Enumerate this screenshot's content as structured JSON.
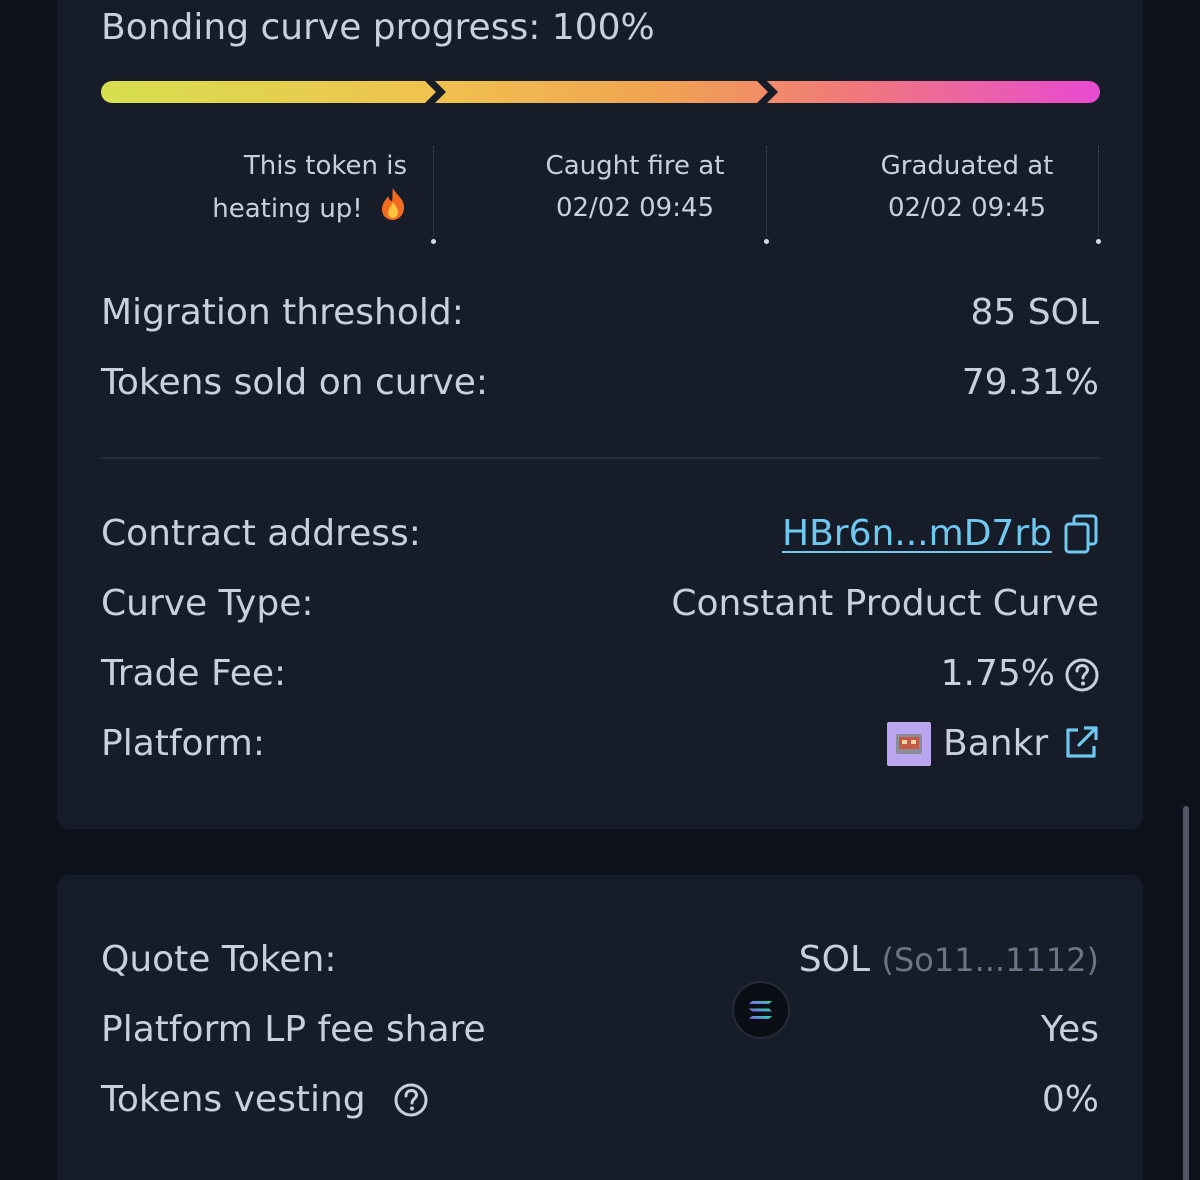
{
  "bonding": {
    "title": "Bonding curve progress: 100%",
    "progress_fraction": 1.0,
    "gradient_colors": [
      "#d6df4f",
      "#f0a550",
      "#f0797a",
      "#e84ad2"
    ],
    "milestones": [
      {
        "line1": "This token is",
        "line2": "heating up!",
        "emoji": "🔥"
      },
      {
        "line1": "Caught fire at",
        "line2": "02/02 09:45"
      },
      {
        "line1": "Graduated at",
        "line2": "02/02 09:45"
      }
    ]
  },
  "curve_stats": {
    "migration_label": "Migration threshold:",
    "migration_value": "85 SOL",
    "tokens_sold_label": "Tokens sold on curve:",
    "tokens_sold_value": "79.31%"
  },
  "details": {
    "contract_label": "Contract address:",
    "contract_value": "HBr6n...mD7rb",
    "curve_type_label": "Curve Type:",
    "curve_type_value": "Constant Product Curve",
    "trade_fee_label": "Trade Fee:",
    "trade_fee_value": "1.75%",
    "platform_label": "Platform:",
    "platform_value": "Bankr"
  },
  "quote": {
    "quote_label": "Quote Token:",
    "quote_symbol": "SOL",
    "quote_address": "(So11...1112)",
    "lp_fee_label": "Platform LP fee share",
    "lp_fee_value": "Yes",
    "vesting_label": "Tokens vesting",
    "vesting_value": "0%"
  },
  "colors": {
    "background": "#0d111b",
    "card": "#171c29",
    "text": "#c9cfdd",
    "link": "#6fc8ef",
    "muted": "#6c7384"
  },
  "icons": [
    "fire-icon",
    "copy-icon",
    "help-circle-icon",
    "external-link-icon",
    "solana-icon",
    "bankr-logo-icon"
  ]
}
